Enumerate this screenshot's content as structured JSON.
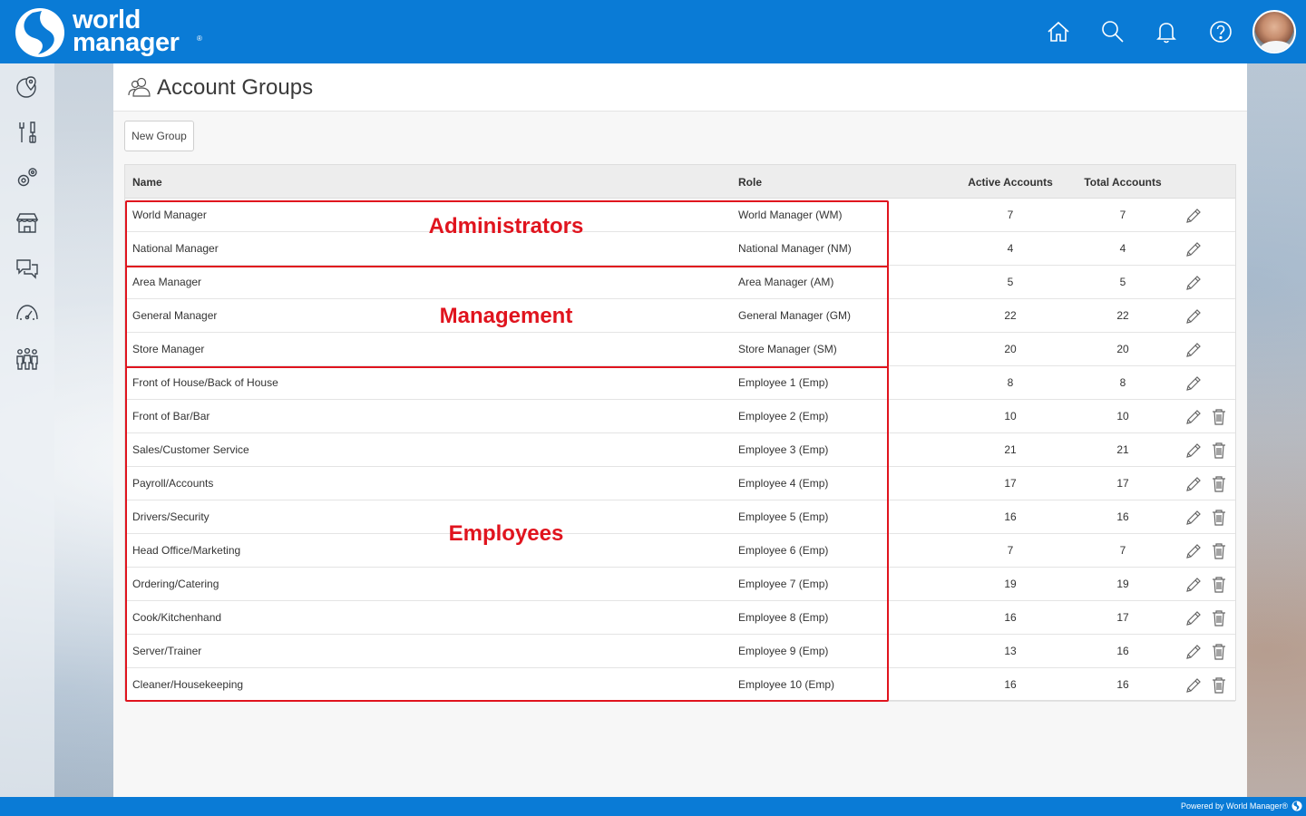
{
  "header": {
    "logo_line1": "world",
    "logo_line2": "manager",
    "logo_reg": "®",
    "icons": [
      "home-icon",
      "search-icon",
      "bell-icon",
      "help-icon"
    ]
  },
  "sidebar": {
    "items": [
      "map-pin-icon",
      "tools-icon",
      "settings-gears-icon",
      "store-icon",
      "chat-icon",
      "dashboard-gauge-icon",
      "people-icon"
    ],
    "expand": "»"
  },
  "page": {
    "title": "Account Groups",
    "new_button": "New Group"
  },
  "table": {
    "headers": {
      "name": "Name",
      "role": "Role",
      "active": "Active Accounts",
      "total": "Total Accounts"
    },
    "rows": [
      {
        "name": "World Manager",
        "role": "World Manager (WM)",
        "active": "7",
        "total": "7",
        "deletable": false
      },
      {
        "name": "National Manager",
        "role": "National Manager (NM)",
        "active": "4",
        "total": "4",
        "deletable": false
      },
      {
        "name": "Area Manager",
        "role": "Area Manager (AM)",
        "active": "5",
        "total": "5",
        "deletable": false
      },
      {
        "name": "General Manager",
        "role": "General Manager (GM)",
        "active": "22",
        "total": "22",
        "deletable": false
      },
      {
        "name": "Store Manager",
        "role": "Store Manager (SM)",
        "active": "20",
        "total": "20",
        "deletable": false
      },
      {
        "name": "Front of House/Back of House",
        "role": "Employee 1 (Emp)",
        "active": "8",
        "total": "8",
        "deletable": false
      },
      {
        "name": "Front of Bar/Bar",
        "role": "Employee 2 (Emp)",
        "active": "10",
        "total": "10",
        "deletable": true
      },
      {
        "name": "Sales/Customer Service",
        "role": "Employee 3 (Emp)",
        "active": "21",
        "total": "21",
        "deletable": true
      },
      {
        "name": "Payroll/Accounts",
        "role": "Employee 4 (Emp)",
        "active": "17",
        "total": "17",
        "deletable": true
      },
      {
        "name": "Drivers/Security",
        "role": "Employee 5 (Emp)",
        "active": "16",
        "total": "16",
        "deletable": true
      },
      {
        "name": "Head Office/Marketing",
        "role": "Employee 6 (Emp)",
        "active": "7",
        "total": "7",
        "deletable": true
      },
      {
        "name": "Ordering/Catering",
        "role": "Employee 7 (Emp)",
        "active": "19",
        "total": "19",
        "deletable": true
      },
      {
        "name": "Cook/Kitchenhand",
        "role": "Employee 8 (Emp)",
        "active": "16",
        "total": "17",
        "deletable": true
      },
      {
        "name": "Server/Trainer",
        "role": "Employee 9 (Emp)",
        "active": "13",
        "total": "16",
        "deletable": true
      },
      {
        "name": "Cleaner/Housekeeping",
        "role": "Employee 10 (Emp)",
        "active": "16",
        "total": "16",
        "deletable": true
      }
    ]
  },
  "annotations": {
    "administrators": "Administrators",
    "management": "Management",
    "employees": "Employees",
    "color": "#e0141e"
  },
  "footer": {
    "text": "Powered by World Manager®"
  },
  "colors": {
    "brand": "#0a7bd6"
  }
}
